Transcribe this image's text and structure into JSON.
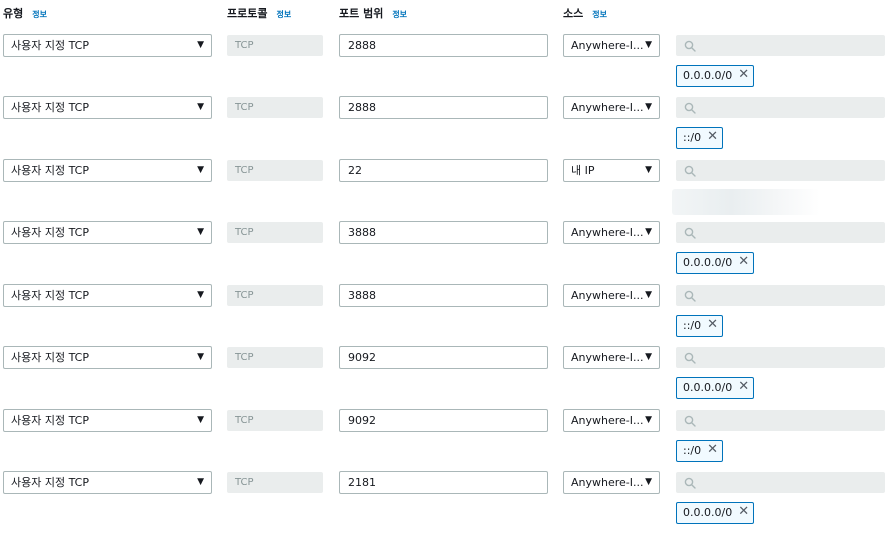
{
  "headers": {
    "type": "유형",
    "protocol": "프로토콜",
    "port_range": "포트 범위",
    "source": "소스",
    "info": "정보"
  },
  "rows": [
    {
      "type": "사용자 지정 TCP",
      "protocol": "TCP",
      "port": "2888",
      "source": "Anywhere-I...",
      "cidr": "0.0.0.0/0"
    },
    {
      "type": "사용자 지정 TCP",
      "protocol": "TCP",
      "port": "2888",
      "source": "Anywhere-I...",
      "cidr": "::/0"
    },
    {
      "type": "사용자 지정 TCP",
      "protocol": "TCP",
      "port": "22",
      "source": "내 IP",
      "cidr": ""
    },
    {
      "type": "사용자 지정 TCP",
      "protocol": "TCP",
      "port": "3888",
      "source": "Anywhere-I...",
      "cidr": "0.0.0.0/0"
    },
    {
      "type": "사용자 지정 TCP",
      "protocol": "TCP",
      "port": "3888",
      "source": "Anywhere-I...",
      "cidr": "::/0"
    },
    {
      "type": "사용자 지정 TCP",
      "protocol": "TCP",
      "port": "9092",
      "source": "Anywhere-I...",
      "cidr": "0.0.0.0/0"
    },
    {
      "type": "사용자 지정 TCP",
      "protocol": "TCP",
      "port": "9092",
      "source": "Anywhere-I...",
      "cidr": "::/0"
    },
    {
      "type": "사용자 지정 TCP",
      "protocol": "TCP",
      "port": "2181",
      "source": "Anywhere-I...",
      "cidr": "0.0.0.0/0"
    }
  ],
  "icons": {
    "caret": "caret-down-icon",
    "search": "search-icon",
    "remove": "close-icon"
  },
  "colors": {
    "info_link": "#0073bb",
    "token_border": "#0073bb",
    "disabled_bg": "#eaeded"
  }
}
